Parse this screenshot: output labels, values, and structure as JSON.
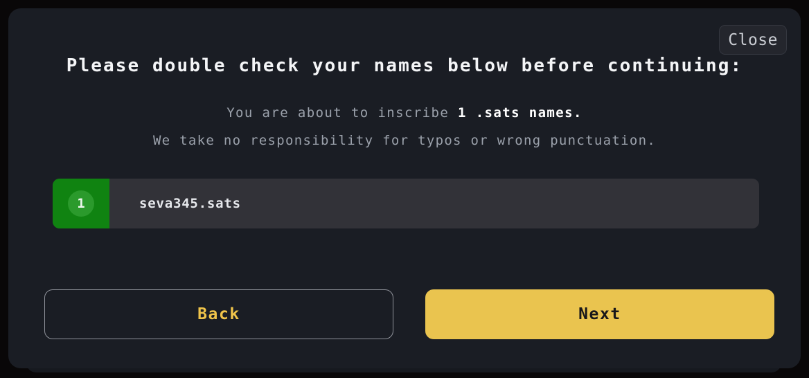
{
  "modal": {
    "close_label": "Close",
    "title": "Please double check your names below before continuing:",
    "subline_1": {
      "lead": "You are about to inscribe",
      "count": "1",
      "suffix": ".sats names."
    },
    "subline_2": "We take no responsibility for typos or wrong punctuation."
  },
  "names": [
    {
      "index": "1",
      "value": "seva345.sats"
    }
  ],
  "actions": {
    "back_label": "Back",
    "next_label": "Next"
  },
  "colors": {
    "page_background": "#090708",
    "modal_background": "#1a1d24",
    "row_background": "#323238",
    "index_block_green": "#108311",
    "index_badge_green": "#2b9a2c",
    "accent_yellow": "#eac44f",
    "back_text_yellow": "#f0c44a",
    "muted_text": "#9ba1ab",
    "primary_text": "#f4f5f7"
  }
}
